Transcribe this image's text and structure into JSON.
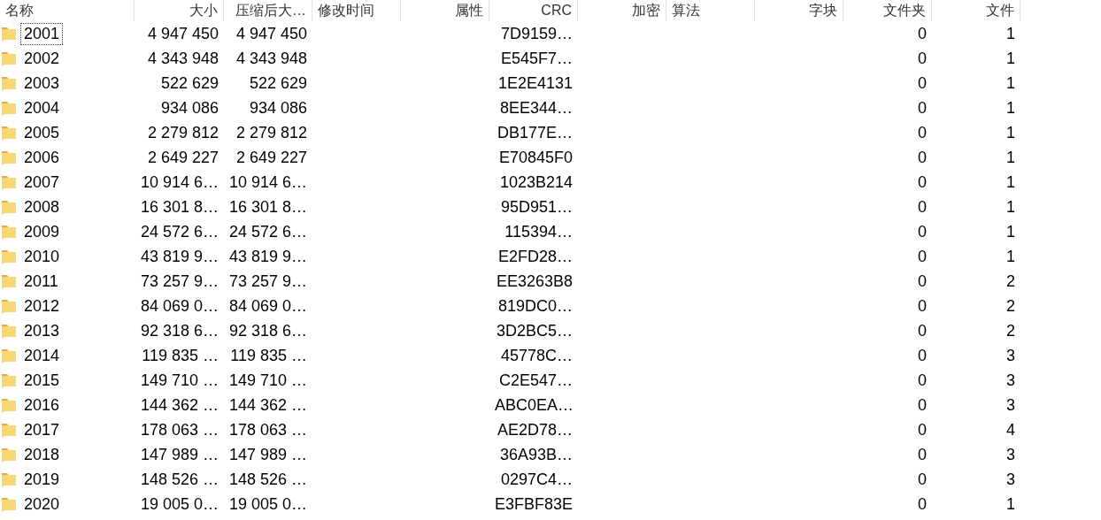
{
  "table": {
    "columns": [
      {
        "label": "名称"
      },
      {
        "label": "大小"
      },
      {
        "label": "压缩后大…"
      },
      {
        "label": "修改时间"
      },
      {
        "label": "属性"
      },
      {
        "label": "CRC"
      },
      {
        "label": "加密"
      },
      {
        "label": "算法"
      },
      {
        "label": "字块"
      },
      {
        "label": "文件夹"
      },
      {
        "label": "文件"
      }
    ],
    "rows": [
      {
        "focused": true,
        "cells": [
          "2001",
          "4 947 450",
          "4 947 450",
          "",
          "",
          "7D9159…",
          "",
          "",
          "",
          "0",
          "1"
        ]
      },
      {
        "focused": false,
        "cells": [
          "2002",
          "4 343 948",
          "4 343 948",
          "",
          "",
          "E545F7…",
          "",
          "",
          "",
          "0",
          "1"
        ]
      },
      {
        "focused": false,
        "cells": [
          "2003",
          "522 629",
          "522 629",
          "",
          "",
          "1E2E4131",
          "",
          "",
          "",
          "0",
          "1"
        ]
      },
      {
        "focused": false,
        "cells": [
          "2004",
          "934 086",
          "934 086",
          "",
          "",
          "8EE344…",
          "",
          "",
          "",
          "0",
          "1"
        ]
      },
      {
        "focused": false,
        "cells": [
          "2005",
          "2 279 812",
          "2 279 812",
          "",
          "",
          "DB177E…",
          "",
          "",
          "",
          "0",
          "1"
        ]
      },
      {
        "focused": false,
        "cells": [
          "2006",
          "2 649 227",
          "2 649 227",
          "",
          "",
          "E70845F0",
          "",
          "",
          "",
          "0",
          "1"
        ]
      },
      {
        "focused": false,
        "cells": [
          "2007",
          "10 914 6…",
          "10 914 6…",
          "",
          "",
          "1023B214",
          "",
          "",
          "",
          "0",
          "1"
        ]
      },
      {
        "focused": false,
        "cells": [
          "2008",
          "16 301 8…",
          "16 301 8…",
          "",
          "",
          "95D951…",
          "",
          "",
          "",
          "0",
          "1"
        ]
      },
      {
        "focused": false,
        "cells": [
          "2009",
          "24 572 6…",
          "24 572 6…",
          "",
          "",
          "115394…",
          "",
          "",
          "",
          "0",
          "1"
        ]
      },
      {
        "focused": false,
        "cells": [
          "2010",
          "43 819 9…",
          "43 819 9…",
          "",
          "",
          "E2FD28…",
          "",
          "",
          "",
          "0",
          "1"
        ]
      },
      {
        "focused": false,
        "cells": [
          "2011",
          "73 257 9…",
          "73 257 9…",
          "",
          "",
          "EE3263B8",
          "",
          "",
          "",
          "0",
          "2"
        ]
      },
      {
        "focused": false,
        "cells": [
          "2012",
          "84 069 0…",
          "84 069 0…",
          "",
          "",
          "819DC0…",
          "",
          "",
          "",
          "0",
          "2"
        ]
      },
      {
        "focused": false,
        "cells": [
          "2013",
          "92 318 6…",
          "92 318 6…",
          "",
          "",
          "3D2BC5…",
          "",
          "",
          "",
          "0",
          "2"
        ]
      },
      {
        "focused": false,
        "cells": [
          "2014",
          "119 835 …",
          "119 835 …",
          "",
          "",
          "45778C…",
          "",
          "",
          "",
          "0",
          "3"
        ]
      },
      {
        "focused": false,
        "cells": [
          "2015",
          "149 710 …",
          "149 710 …",
          "",
          "",
          "C2E547…",
          "",
          "",
          "",
          "0",
          "3"
        ]
      },
      {
        "focused": false,
        "cells": [
          "2016",
          "144 362 …",
          "144 362 …",
          "",
          "",
          "ABC0EA…",
          "",
          "",
          "",
          "0",
          "3"
        ]
      },
      {
        "focused": false,
        "cells": [
          "2017",
          "178 063 …",
          "178 063 …",
          "",
          "",
          "AE2D78…",
          "",
          "",
          "",
          "0",
          "4"
        ]
      },
      {
        "focused": false,
        "cells": [
          "2018",
          "147 989 …",
          "147 989 …",
          "",
          "",
          "36A93B…",
          "",
          "",
          "",
          "0",
          "3"
        ]
      },
      {
        "focused": false,
        "cells": [
          "2019",
          "148 526 …",
          "148 526 …",
          "",
          "",
          "0297C4…",
          "",
          "",
          "",
          "0",
          "3"
        ]
      },
      {
        "focused": false,
        "cells": [
          "2020",
          "19 005 0…",
          "19 005 0…",
          "",
          "",
          "E3FBF83E",
          "",
          "",
          "",
          "0",
          "1"
        ]
      }
    ]
  }
}
